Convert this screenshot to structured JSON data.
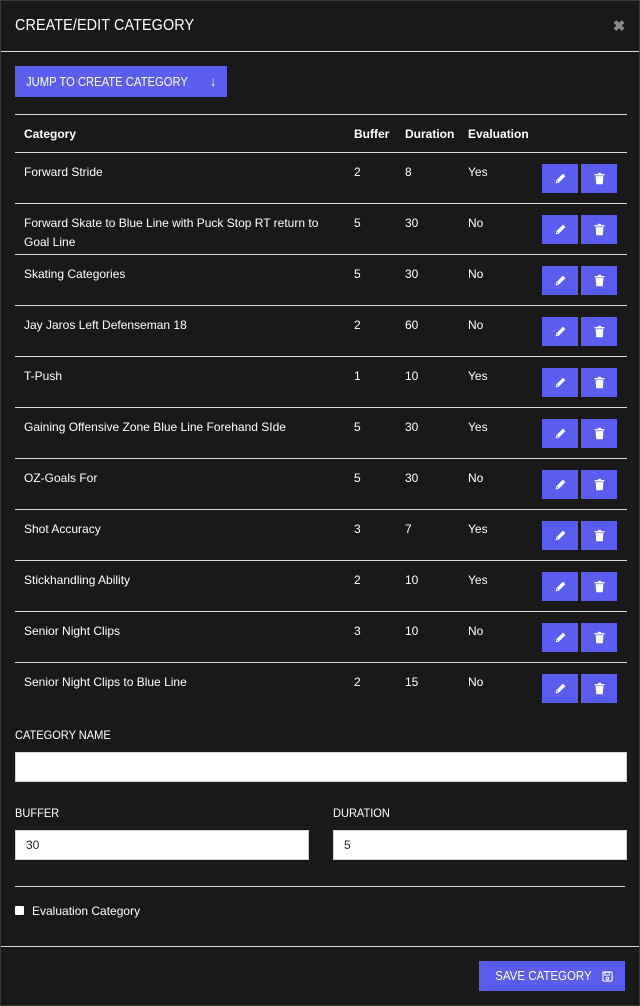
{
  "modal": {
    "title": "CREATE/EDIT CATEGORY",
    "close_icon": "close-icon"
  },
  "jump_button": {
    "label": "JUMP TO CREATE CATEGORY",
    "icon": "arrow-down-icon",
    "icon_glyph": "↓"
  },
  "table": {
    "headers": {
      "category": "Category",
      "buffer": "Buffer",
      "duration": "Duration",
      "evaluation": "Evaluation"
    },
    "rows": [
      {
        "category": "Forward Stride",
        "buffer": "2",
        "duration": "8",
        "evaluation": "Yes"
      },
      {
        "category": "Forward Skate to Blue Line with Puck Stop RT return to Goal Line",
        "buffer": "5",
        "duration": "30",
        "evaluation": "No"
      },
      {
        "category": "Skating Categories",
        "buffer": "5",
        "duration": "30",
        "evaluation": "No"
      },
      {
        "category": "Jay Jaros Left Defenseman 18",
        "buffer": "2",
        "duration": "60",
        "evaluation": "No"
      },
      {
        "category": "T-Push",
        "buffer": "1",
        "duration": "10",
        "evaluation": "Yes"
      },
      {
        "category": "Gaining Offensive Zone Blue Line Forehand SIde",
        "buffer": "5",
        "duration": "30",
        "evaluation": "Yes"
      },
      {
        "category": "OZ-Goals For",
        "buffer": "5",
        "duration": "30",
        "evaluation": "No"
      },
      {
        "category": "Shot Accuracy",
        "buffer": "3",
        "duration": "7",
        "evaluation": "Yes"
      },
      {
        "category": "Stickhandling Ability",
        "buffer": "2",
        "duration": "10",
        "evaluation": "Yes"
      },
      {
        "category": "Senior Night Clips",
        "buffer": "3",
        "duration": "10",
        "evaluation": "No"
      },
      {
        "category": "Senior Night Clips to Blue Line",
        "buffer": "2",
        "duration": "15",
        "evaluation": "No"
      }
    ],
    "row_actions": [
      "edit-icon",
      "trash-icon"
    ]
  },
  "form": {
    "category_name": {
      "label": "CATEGORY NAME",
      "value": ""
    },
    "buffer": {
      "label": "BUFFER",
      "value": "30"
    },
    "duration": {
      "label": "DURATION",
      "value": "5"
    },
    "evaluation_checkbox": {
      "label": "Evaluation Category",
      "checked": false
    }
  },
  "footer": {
    "save_label": "SAVE CATEGORY",
    "save_icon": "save-icon"
  },
  "colors": {
    "background": "#191919",
    "accent": "#5a5ded",
    "text": "#ffffff",
    "divider": "#d9d9d9"
  }
}
